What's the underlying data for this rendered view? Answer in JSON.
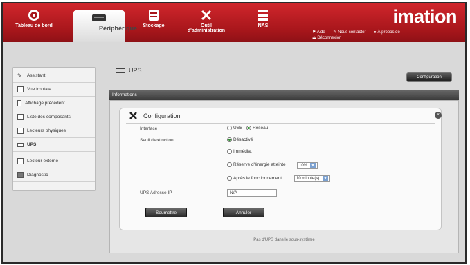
{
  "brand": "imation",
  "nav": {
    "dashboard": "Tableau de bord",
    "device": "Périphérique",
    "storage": "Stockage",
    "admin_tool": "Outil d'administration",
    "nas": "NAS"
  },
  "top_links": {
    "help": "Aide",
    "contact": "Nous contacter",
    "about": "À propos de",
    "logout": "Déconnexion"
  },
  "sidebar": {
    "items": [
      {
        "label": "Assistant"
      },
      {
        "label": "Vue frontale"
      },
      {
        "label": "Affichage précédent"
      },
      {
        "label": "Liste des composants"
      },
      {
        "label": "Lecteurs physiques"
      },
      {
        "label": "UPS"
      },
      {
        "label": "Lecteur externe"
      },
      {
        "label": "Diagnostic"
      }
    ]
  },
  "page": {
    "title": "UPS",
    "config_button": "Configuration",
    "info_bar": "Informations",
    "panel_title": "Configuration",
    "footnote": "Pas d'UPS dans le sous-système"
  },
  "form": {
    "interface_label": "Interface",
    "interface_usb": "USB",
    "interface_network": "Réseau",
    "threshold_label": "Seuil d'extinction",
    "opt_disabled": "Désactivé",
    "opt_immediate": "Immédiat",
    "opt_reserve": "Réserve d'énergie atteinte",
    "reserve_value": "10%",
    "opt_after": "Après le fonctionnement",
    "after_value": "10 minute(s)",
    "ip_label": "UPS Adresse IP",
    "ip_value": "N/A",
    "submit": "Soumettre",
    "cancel": "Annuler"
  }
}
